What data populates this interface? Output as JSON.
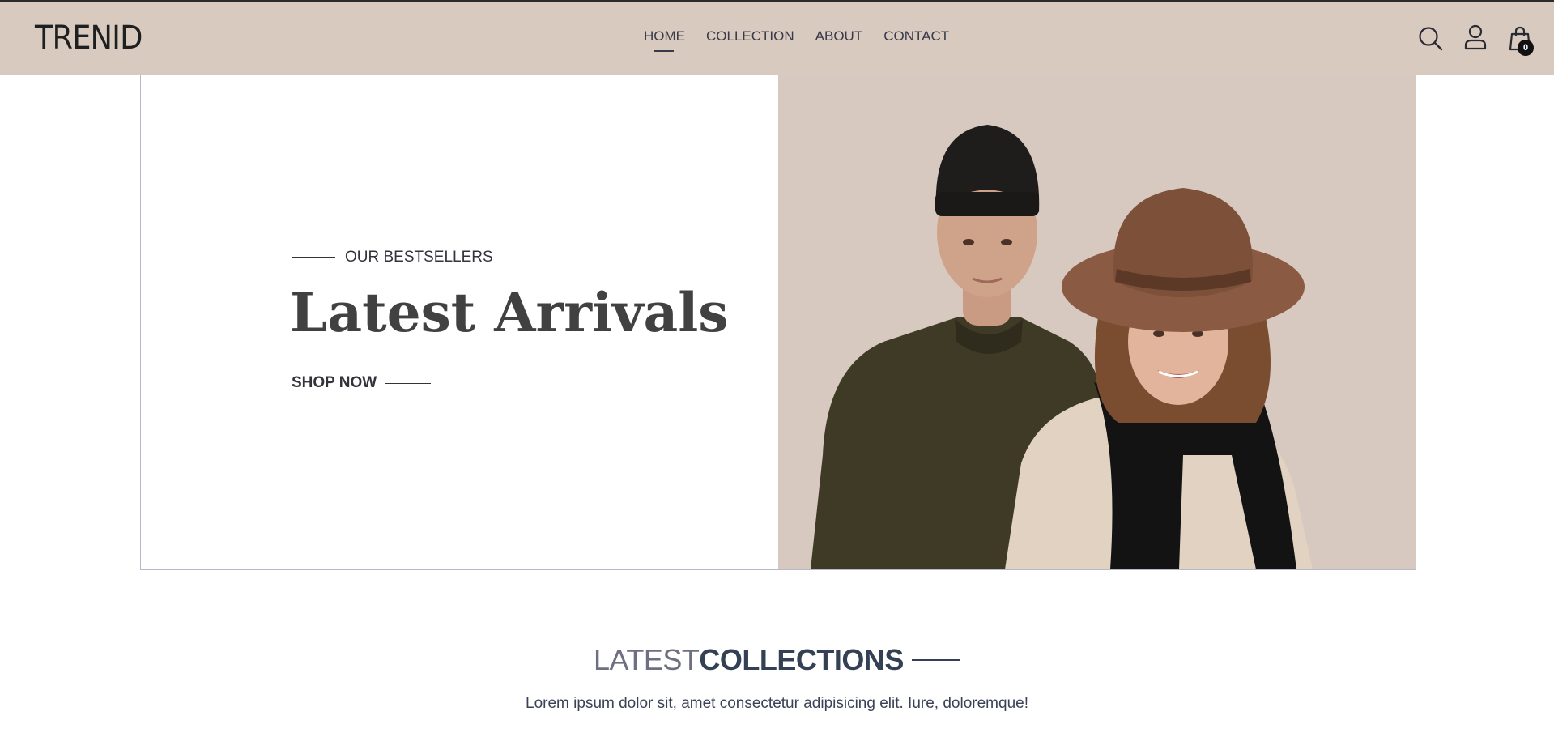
{
  "header": {
    "logo": "TRENID",
    "nav": [
      "HOME",
      "COLLECTION",
      "ABOUT",
      "CONTACT"
    ],
    "active_nav": "HOME",
    "icons": [
      "search-icon",
      "user-icon",
      "shopping-bag-icon"
    ],
    "cart_count": "0"
  },
  "hero": {
    "eyebrow": "OUR BESTSELLERS",
    "title": "Latest Arrivals",
    "cta": "SHOP NOW",
    "image": "photo of a man in a dark beanie and green sweater beside a smiling woman in a brown hat and black scarf"
  },
  "collections": {
    "title_light": "LATEST",
    "title_bold": "COLLECTIONS",
    "description": "Lorem ipsum dolor sit, amet consectetur adipisicing elit. Iure, doloremque!"
  },
  "colors": {
    "header_bg": "#d8cabf",
    "hero_image_bg": "#d7c9bf",
    "text_dark": "#33333c",
    "accent": "#344054"
  }
}
